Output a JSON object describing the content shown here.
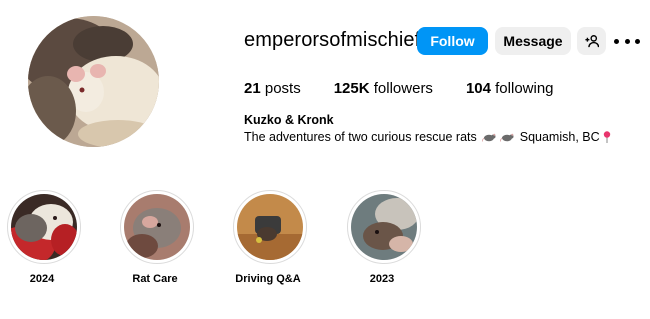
{
  "profile": {
    "username": "emperorsofmischief",
    "full_name": "Kuzko & Kronk",
    "bio_text": "The adventures of two curious rescue rats",
    "bio_location": "Squamish, BC",
    "avatar_icon": "rat-photo-avatar"
  },
  "actions": {
    "follow_label": "Follow",
    "message_label": "Message",
    "add_user_icon": "add-user-icon",
    "more_icon": "more-options-icon"
  },
  "stats": {
    "posts_count": "21",
    "posts_label": "posts",
    "followers_count": "125K",
    "followers_label": "followers",
    "following_count": "104",
    "following_label": "following"
  },
  "highlights": [
    {
      "label": "2024"
    },
    {
      "label": "Rat Care"
    },
    {
      "label": "Driving Q&A"
    },
    {
      "label": "2023"
    }
  ],
  "colors": {
    "follow_button": "#0095f6",
    "secondary_button": "#efefef"
  }
}
